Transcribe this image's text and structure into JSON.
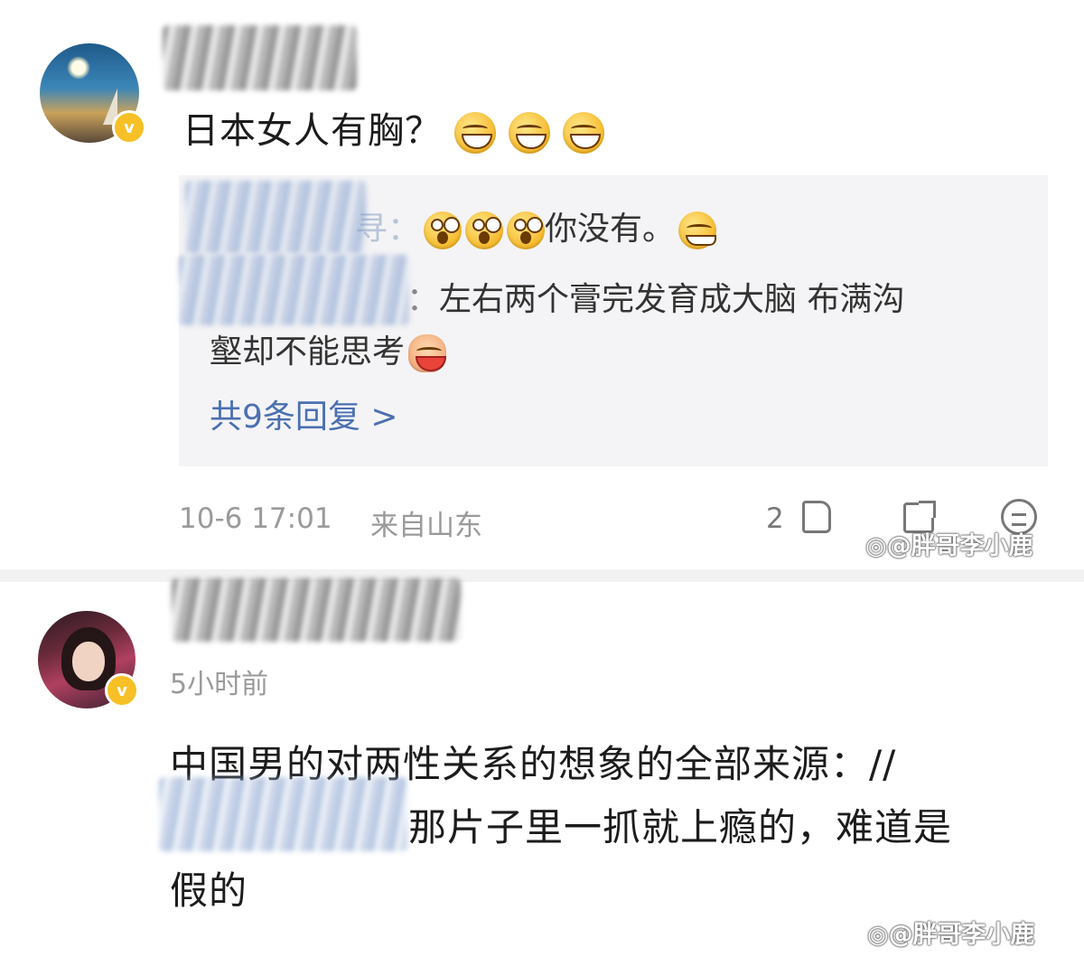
{
  "comment1": {
    "text": "日本女人有胸？",
    "emojis": [
      "grin-icon",
      "grin-icon",
      "grin-icon"
    ],
    "replies": [
      {
        "prefix": "寻：",
        "text": "你没有。"
      },
      {
        "prefix": "：",
        "text": "左右两个膏完发育成大脑 布满沟",
        "text_cont": "壑却不能思考"
      }
    ],
    "reply_link": "共9条回复 >",
    "time": "10-6 17:01",
    "location": "来自山东",
    "like_count": "2"
  },
  "comment2": {
    "time": "5小时前",
    "line1": "中国男的对两性关系的想象的全部来源：//",
    "line2": "那片子里一抓就上瘾的，难道是",
    "line3": "假的"
  },
  "watermark": "@胖哥李小鹿",
  "colors": {
    "link": "#4a70b0",
    "meta": "#9a9a9a",
    "reply_bg": "#f4f4f6",
    "badge": "#f6c026"
  }
}
